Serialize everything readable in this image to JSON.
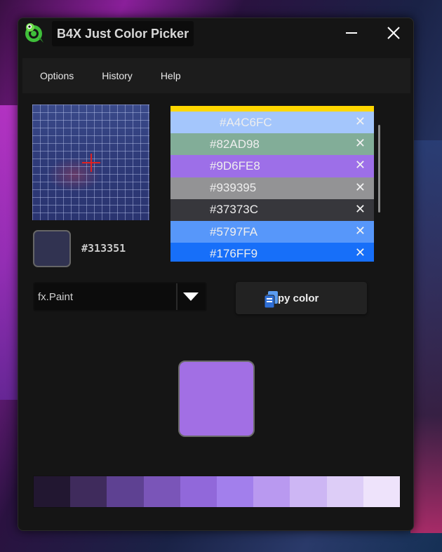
{
  "window": {
    "title": "B4X Just Color Picker"
  },
  "menu": {
    "items": [
      "Options",
      "History",
      "Help"
    ]
  },
  "picker": {
    "current_color": "#313351",
    "current_hex": "#313351"
  },
  "history": {
    "top_color": "#FFD700",
    "items": [
      {
        "hex": "#A4C6FC",
        "color": "#A4C6FC"
      },
      {
        "hex": "#82AD98",
        "color": "#82AD98"
      },
      {
        "hex": "#9D6FE8",
        "color": "#9D6FE8"
      },
      {
        "hex": "#939395",
        "color": "#939395"
      },
      {
        "hex": "#37373C",
        "color": "#37373C"
      },
      {
        "hex": "#5797FA",
        "color": "#5797FA"
      },
      {
        "hex": "#176FF9",
        "color": "#176FF9"
      }
    ],
    "remove_glyph": "✕"
  },
  "format": {
    "selected": "fx.Paint"
  },
  "copy_button": {
    "label": "Copy color"
  },
  "preview": {
    "color": "#A26FE4"
  },
  "shades": [
    "#221731",
    "#3F2B5C",
    "#5E4192",
    "#7A55B8",
    "#9168DA",
    "#A27FEC",
    "#B999F0",
    "#CDB6F4",
    "#DDCDF7",
    "#EEE3FB"
  ]
}
